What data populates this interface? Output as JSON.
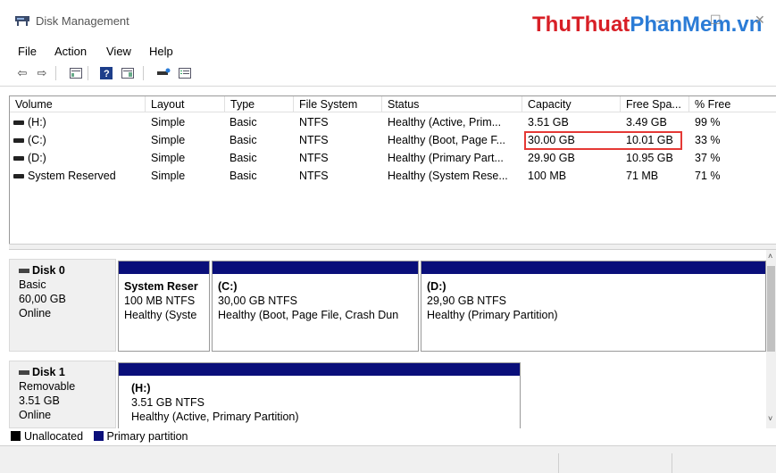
{
  "window": {
    "title": "Disk Management",
    "minimize": "—",
    "maximize": "☐",
    "close": "✕"
  },
  "watermark": {
    "part1": "ThuThuat",
    "part2": "PhanMem",
    "part3": ".vn"
  },
  "menu": [
    "File",
    "Action",
    "View",
    "Help"
  ],
  "toolbar": {
    "icons": [
      "back-icon",
      "forward-icon",
      "console-tree-icon",
      "help-icon",
      "show-pane-icon",
      "properties-icon",
      "list-icon"
    ]
  },
  "volumes": {
    "headers": [
      "Volume",
      "Layout",
      "Type",
      "File System",
      "Status",
      "Capacity",
      "Free Spa...",
      "% Free"
    ],
    "rows": [
      [
        "(H:)",
        "Simple",
        "Basic",
        "NTFS",
        "Healthy (Active, Prim...",
        "3.51 GB",
        "3.49 GB",
        "99 %"
      ],
      [
        "(C:)",
        "Simple",
        "Basic",
        "NTFS",
        "Healthy (Boot, Page F...",
        "30.00 GB",
        "10.01 GB",
        "33 %"
      ],
      [
        "(D:)",
        "Simple",
        "Basic",
        "NTFS",
        "Healthy (Primary Part...",
        "29.90 GB",
        "10.95 GB",
        "37 %"
      ],
      [
        "System Reserved",
        "Simple",
        "Basic",
        "NTFS",
        "Healthy (System Rese...",
        "100 MB",
        "71 MB",
        "71 %"
      ]
    ]
  },
  "disks": [
    {
      "name": "Disk 0",
      "type": "Basic",
      "size": "60,00 GB",
      "state": "Online",
      "partitions": [
        {
          "name": "System Reser",
          "size": "100 MB NTFS",
          "status": "Healthy (Syste"
        },
        {
          "name": "(C:)",
          "size": "30,00 GB NTFS",
          "status": "Healthy (Boot, Page File, Crash Dun"
        },
        {
          "name": "(D:)",
          "size": "29,90 GB NTFS",
          "status": "Healthy (Primary Partition)"
        }
      ]
    },
    {
      "name": "Disk 1",
      "type": "Removable",
      "size": "3.51 GB",
      "state": "Online",
      "partitions": [
        {
          "name": "(H:)",
          "size": "3.51 GB NTFS",
          "status": "Healthy (Active, Primary Partition)"
        }
      ]
    }
  ],
  "legend": {
    "unallocated": "Unallocated",
    "primary": "Primary partition",
    "colors": {
      "unallocated": "#000000",
      "primary": "#0a0f7a"
    }
  },
  "colors": {
    "highlight": "#e53935",
    "partition_bar": "#0a0f7a"
  }
}
